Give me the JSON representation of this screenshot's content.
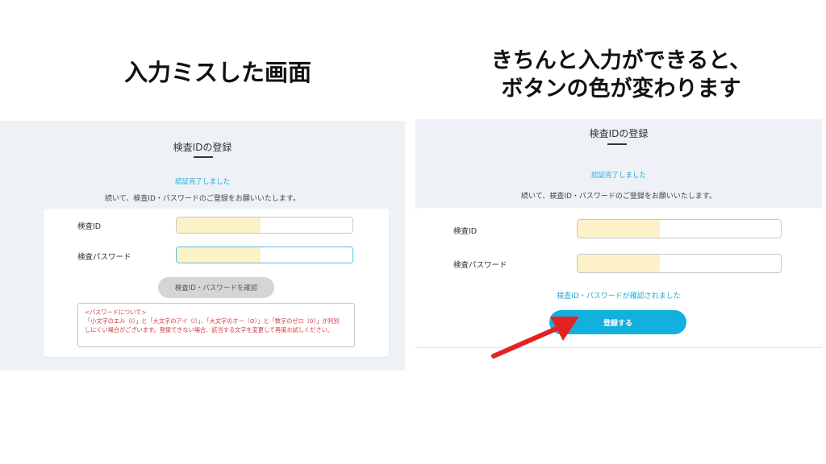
{
  "left": {
    "heading": "入力ミスした画面",
    "panel_title": "検査IDの登録",
    "verified_text": "認証完了しました",
    "instruction": "続いて、検査ID・パスワードのご登録をお願いいたします。",
    "id_label": "検査ID",
    "password_label": "検査パスワード",
    "confirm_button": "検査ID・パスワードを確認",
    "notice": {
      "title": "<パスワードについて>",
      "line1": "「小文字のエル（l）」と「大文字のアイ（I）」、「大文字のオー（O）」と「数字のゼロ（0）」が判別",
      "line2": "しにくい場合がございます。登録できない場合、該当する文字を変更して再度お試しください。"
    }
  },
  "right": {
    "heading_line1": "きちんと入力ができると、",
    "heading_line2": "ボタンの色が変わります",
    "panel_title": "検査IDの登録",
    "verified_text": "認証完了しました",
    "instruction": "続いて、検査ID・パスワードのご登録をお願いいたします。",
    "id_label": "検査ID",
    "password_label": "検査パスワード",
    "confirmed_text": "検査ID・パスワードが確認されました",
    "register_button": "登録する"
  },
  "colors": {
    "accent": "#11b0de",
    "link": "#1fa8d6",
    "error": "#d33a3a",
    "disabled_button": "#d5d5d5",
    "redaction": "#fdf1c7",
    "arrow": "#e52222"
  }
}
